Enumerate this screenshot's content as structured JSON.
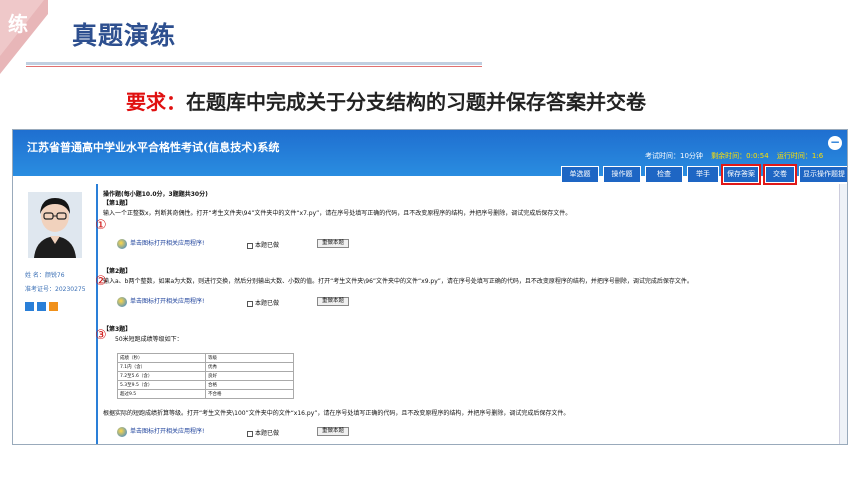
{
  "slide": {
    "corner_char": "练",
    "title": "真题演练",
    "requirement_label": "要求：",
    "requirement_text": "在题库中完成关于分支结构的习题并保存答案并交卷"
  },
  "colors": {
    "accent": "#2a7fd8",
    "highlight": "#e01818",
    "title": "#2d4f8f"
  },
  "system": {
    "title": "江苏省普通高中学业水平合格性考试(信息技术)系统",
    "status": {
      "exam_time": "考试时间：10分钟",
      "remaining": "剩余时间：0:0:54",
      "running": "运行时间：1:6"
    },
    "min_button": "−",
    "toolbar": [
      "单选题",
      "操作题",
      "检查",
      "举手",
      "保存答案",
      "交卷",
      "显示操作题提示"
    ],
    "user": {
      "name": "姓    名：颜锐76",
      "ticket": "准考证号：20230275"
    }
  },
  "content": {
    "section_header": "操作题(每小题10.0分，3题题共30分)",
    "q1": {
      "label": "【第1题】",
      "text": "输入一个正整数x，判断其奇偶性。打开“考生文件夹\\94”文件夹中的文件“x7.py”，请在序号处填写正确的代码，且不改变原程序的结构，并把序号删除，调试完成后保存文件。",
      "num": "①"
    },
    "q2": {
      "label": "【第2题】",
      "text": "输入a、b两个整数，如果a为大数，则进行交换，然后分别输出大数、小数的值。打开“考生文件夹\\96”文件夹中的文件“x9.py”，请在序号处填写正确的代码，且不改变原程序的结构，并把序号删除，调试完成后保存文件。",
      "num": "②"
    },
    "q3": {
      "label": "【第3题】",
      "intro": "50米短跑成绩等级如下：",
      "num": "③",
      "table": [
        [
          "成绩（秒）",
          "等级"
        ],
        [
          "7.1内（含）",
          "优秀"
        ],
        [
          "7.2至5.6（含）",
          "良好"
        ],
        [
          "5.3至9.5（含）",
          "合格"
        ],
        [
          "超过9.5",
          "不合格"
        ]
      ],
      "text": "根据实际的短跑成绩折算等级。打开“考生文件夹\\100”文件夹中的文件“x16.py”，请在序号处填写正确的代码，且不改变原程序的结构，并把序号删除，调试完成后保存文件。"
    },
    "run_link": "单击图标打开相关应用程序!",
    "marked": "本题已做",
    "redo": "重做本题"
  }
}
